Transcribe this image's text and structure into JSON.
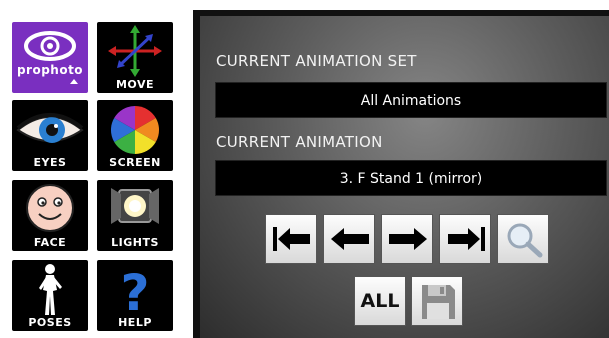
{
  "sidebar": {
    "tiles": [
      {
        "id": "prophoto",
        "label": "prophoto",
        "icon": "eye-logo-icon"
      },
      {
        "id": "move",
        "label": "MOVE",
        "icon": "move-arrows-icon"
      },
      {
        "id": "eyes",
        "label": "EYES",
        "icon": "eye-icon"
      },
      {
        "id": "screen",
        "label": "SCREEN",
        "icon": "color-wheel-icon"
      },
      {
        "id": "face",
        "label": "FACE",
        "icon": "smiley-face-icon"
      },
      {
        "id": "lights",
        "label": "LIGHTS",
        "icon": "spotlight-icon"
      },
      {
        "id": "poses",
        "label": "POSES",
        "icon": "figure-silhouette-icon"
      },
      {
        "id": "help",
        "label": "HELP",
        "icon": "question-mark-icon"
      }
    ]
  },
  "panel": {
    "animation_set_header": "CURRENT ANIMATION SET",
    "animation_set_value": "All Animations",
    "animation_header": "CURRENT ANIMATION",
    "animation_value": "3. F Stand 1 (mirror)",
    "buttons": {
      "first": "first-arrow-icon",
      "prev": "left-arrow-icon",
      "next": "right-arrow-icon",
      "last": "last-arrow-icon",
      "search": "magnifier-icon",
      "all_label": "ALL",
      "save": "floppy-disk-icon"
    }
  },
  "colors": {
    "brand": "#7a2fc0",
    "help": "#2b6fd6"
  }
}
